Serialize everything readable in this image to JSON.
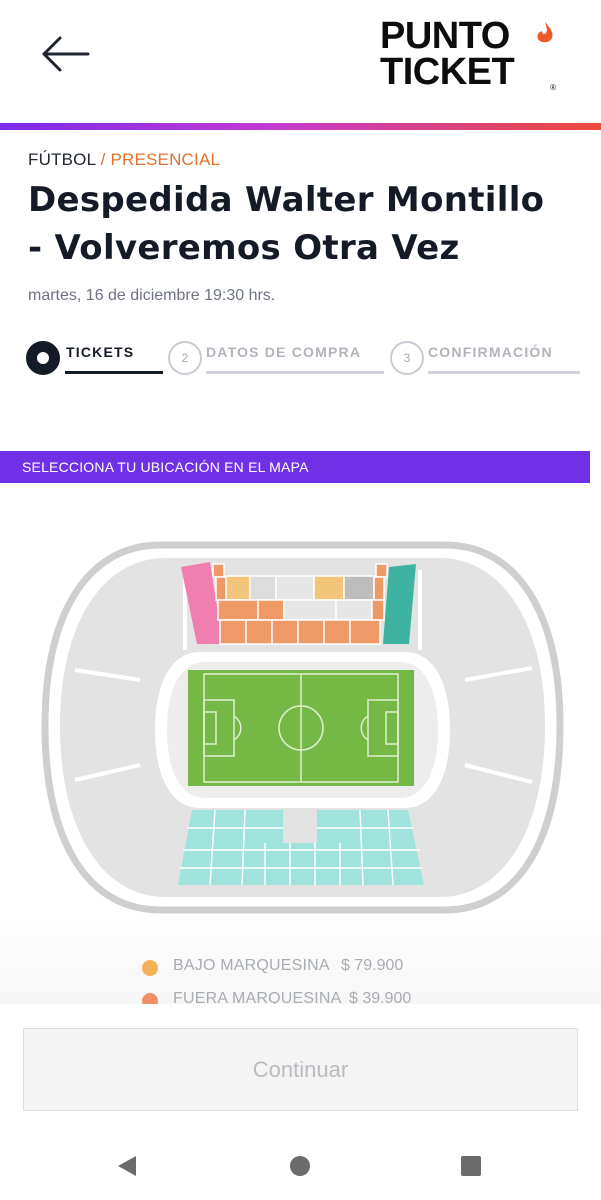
{
  "header": {
    "back_icon": "arrow-left-icon",
    "logo": {
      "line1": "PUNTO",
      "line2": "TICKET",
      "mark": "®"
    },
    "accent_gradient": [
      "#7b2be8",
      "#c23ad0",
      "#ee4a3a"
    ]
  },
  "event": {
    "category": "FÚTBOL",
    "separator": "/",
    "mode": "PRESENCIAL",
    "title": "Despedida Walter Montillo - Volveremos Otra Vez",
    "date": "martes, 16 de diciembre 19:30 hrs."
  },
  "stepper": {
    "steps": [
      {
        "number": "",
        "label": "TICKETS",
        "active": true
      },
      {
        "number": "2",
        "label": "DATOS DE COMPRA",
        "active": false
      },
      {
        "number": "3",
        "label": "CONFIRMACIÓN",
        "active": false
      }
    ]
  },
  "map_section": {
    "banner": "SELECCIONA TU UBICACIÓN EN EL MAPA",
    "banner_color": "#7031e6"
  },
  "prices": [
    {
      "name": "BAJO MARQUESINA",
      "price": "$ 79.900",
      "color": "#f3b15a"
    },
    {
      "name": "FUERA MARQUESINA",
      "price": "$ 39.900",
      "color": "#ee8f66"
    }
  ],
  "footer": {
    "continue_label": "Continuar"
  },
  "navbar": {
    "back_icon": "nav-back-icon",
    "home_icon": "nav-home-icon",
    "recents_icon": "nav-recents-icon"
  }
}
